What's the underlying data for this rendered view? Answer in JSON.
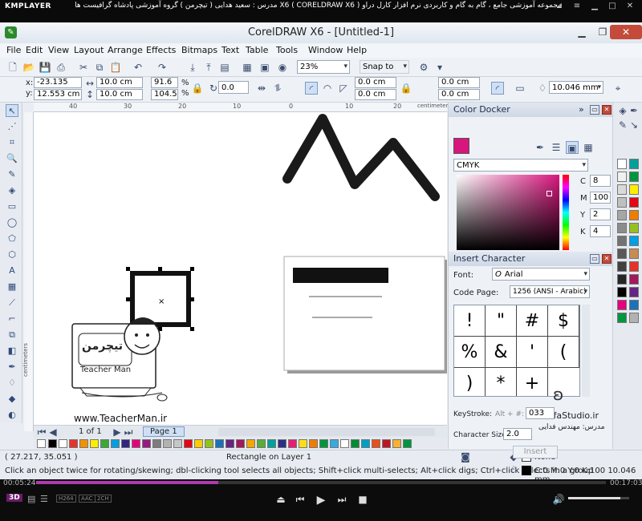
{
  "kmplayer": {
    "logo": "KMPLAYER",
    "title": "مجموعه آموزشی جامع ، گام به گام و کاربردی نرم افزار کارل دراو X6 ( CORELDRAW X6 )    مدرس : سعید هدایی ( تیچرمن ) گروه آموزشی پادشاه گرافیست ها",
    "time_elapsed": "00:05:24",
    "time_total": "00:17:03",
    "progress": 0.32,
    "badges": [
      "3D",
      "H264",
      "AAC",
      "2CH"
    ],
    "volume": 0.85
  },
  "window": {
    "title": "CorelDRAW X6 - [Untitled-1]",
    "app_icon": "coreldraw-icon"
  },
  "menu": [
    "File",
    "Edit",
    "View",
    "Layout",
    "Arrange",
    "Effects",
    "Bitmaps",
    "Text",
    "Table",
    "Tools",
    "Window",
    "Help"
  ],
  "toolbar": {
    "zoom": "23%",
    "snap_to": "Snap to"
  },
  "property_bar": {
    "x_label": "x:",
    "y_label": "y:",
    "x": "-23.135 cm",
    "y": "12.553 cm",
    "width": "10.0 cm",
    "height": "10.0 cm",
    "scale_w": "91.6",
    "scale_h": "104.5",
    "percent": "%",
    "rotation": "0.0",
    "corner_tl": "0.0 cm",
    "corner_bl": "0.0 cm",
    "corner_tr": "0.0 cm",
    "corner_br": "0.0 cm",
    "outline_width": "10.046 mm"
  },
  "ruler": {
    "units": "centimeters",
    "h_ticks": [
      "40",
      "30",
      "20",
      "10",
      "0",
      "10",
      "20"
    ]
  },
  "page_nav": {
    "page_count": "1 of 1",
    "page_tab": "Page 1"
  },
  "status": {
    "coords": "( 27.217, 35.051 )",
    "object_info": "Rectangle on Layer 1",
    "hint": "Click an object twice for rotating/skewing; dbl-clicking tool selects all objects; Shift+click multi-selects; Alt+click digs; Ctrl+click selects in a group",
    "fill_label": "None",
    "outline_info": "C:0 M:0 Y:0 K:100  10.046 mm"
  },
  "color_docker": {
    "title": "Color Docker",
    "model": "CMYK",
    "c": "8",
    "m": "100",
    "y": "2",
    "k": "4",
    "c_label": "C",
    "m_label": "M",
    "y_label": "Y",
    "k_label": "K",
    "current_color": "#d9157e"
  },
  "insert_character": {
    "title": "Insert Character",
    "font_label": "Font:",
    "font": "Arial",
    "code_page_label": "Code Page:",
    "code_page": "1256  (ANSI - Arabic)",
    "glyphs": [
      "!",
      "\"",
      "#",
      "$",
      "%",
      "&",
      "'",
      "(",
      ")",
      "*",
      "+"
    ],
    "keystroke_label": "KeyStroke:",
    "keystroke_prefix": "Alt + #:",
    "keystroke": "033",
    "char_size_label": "Character Size:",
    "char_size": "2.0",
    "insert_label": "Insert"
  },
  "watermark": {
    "url": "www.TeacherMan.ir",
    "logo_text": "تیچرمن",
    "teacher_man": "Teacher Man",
    "safa": "safaStudio.ir",
    "safa_teacher": "مدرس: مهندس فدایی"
  },
  "palette_colors": [
    "#000000",
    "#ffffff",
    "#e6332a",
    "#f39200",
    "#ffed00",
    "#3aaa35",
    "#009fe3",
    "#312783",
    "#e5007d",
    "#951b81",
    "#7d7d7d",
    "#b2b2b2",
    "#c6c6c6",
    "#e30613",
    "#ffcc00",
    "#95c11f",
    "#1d71b8",
    "#662483",
    "#a3195b",
    "#f7a600",
    "#56ae37",
    "#00a19a",
    "#2d2e83",
    "#e71d73",
    "#ffde17",
    "#ef7d00",
    "#009640",
    "#36a9e1",
    "#ffffff",
    "#008d36",
    "#00a0c6",
    "#e94e1b",
    "#bd1622",
    "#f8b133",
    "#00963f"
  ],
  "vpalette_colors": [
    "#ffffff",
    "#f0f0f0",
    "#d9d9d9",
    "#bfbfbf",
    "#a6a6a6",
    "#8c8c8c",
    "#737373",
    "#595959",
    "#404040",
    "#262626",
    "#000000",
    "#e5007d",
    "#009640",
    "#00a19a",
    "#00963f",
    "#ffed00",
    "#e30613",
    "#ef7d00",
    "#95c11f",
    "#009fe3",
    "#c68c53",
    "#e6332a",
    "#a3195b",
    "#662483",
    "#1d71b8",
    "#b2b2b2"
  ]
}
